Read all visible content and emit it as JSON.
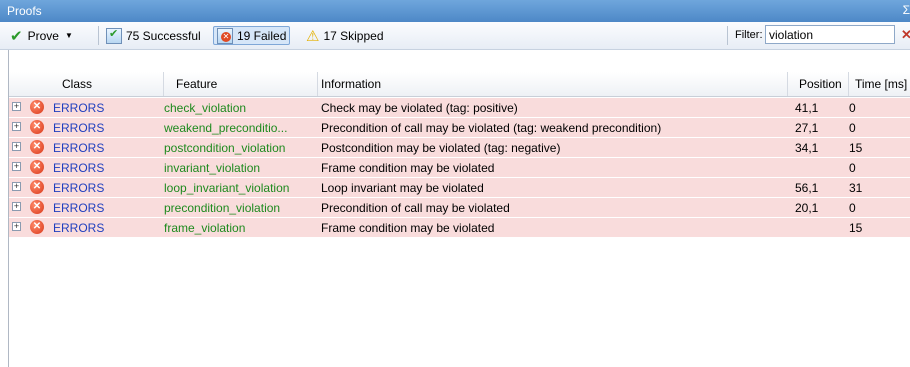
{
  "panel": {
    "title": "Proofs",
    "pin_glyph": "Σ"
  },
  "toolbar": {
    "prove_label": "Prove",
    "successful_label": "75 Successful",
    "failed_label": "19 Failed",
    "skipped_label": "17 Skipped",
    "filter_label": "Filter:",
    "filter_value": "violation"
  },
  "columns": {
    "class": "Class",
    "feature": "Feature",
    "information": "Information",
    "position": "Position",
    "time": "Time [ms]"
  },
  "rows": [
    {
      "class": "ERRORS",
      "feature": "check_violation",
      "information": "Check may be violated (tag: positive)",
      "position": "41,1",
      "time": "0"
    },
    {
      "class": "ERRORS",
      "feature": "weakend_preconditio...",
      "information": "Precondition of call may be violated (tag: weakend precondition)",
      "position": "27,1",
      "time": "0"
    },
    {
      "class": "ERRORS",
      "feature": "postcondition_violation",
      "information": "Postcondition may be violated (tag: negative)",
      "position": "34,1",
      "time": "15"
    },
    {
      "class": "ERRORS",
      "feature": "invariant_violation",
      "information": "Frame condition may be violated",
      "position": "",
      "time": "0"
    },
    {
      "class": "ERRORS",
      "feature": "loop_invariant_violation",
      "information": "Loop invariant may be violated",
      "position": "56,1",
      "time": "31"
    },
    {
      "class": "ERRORS",
      "feature": "precondition_violation",
      "information": "Precondition of call may be violated",
      "position": "20,1",
      "time": "0"
    },
    {
      "class": "ERRORS",
      "feature": "frame_violation",
      "information": "Frame condition may be violated",
      "position": "",
      "time": "15"
    }
  ],
  "colors": {
    "row_failed_bg": "#f9dcdc",
    "class_text": "#1f3fbf",
    "feature_text": "#1e8a1e",
    "title_bar": "#4d88c7"
  },
  "icons": [
    "check-icon",
    "dropdown-arrow-icon",
    "successful-icon",
    "failed-icon",
    "warning-icon",
    "clear-filter-icon",
    "expand-icon",
    "error-icon"
  ]
}
